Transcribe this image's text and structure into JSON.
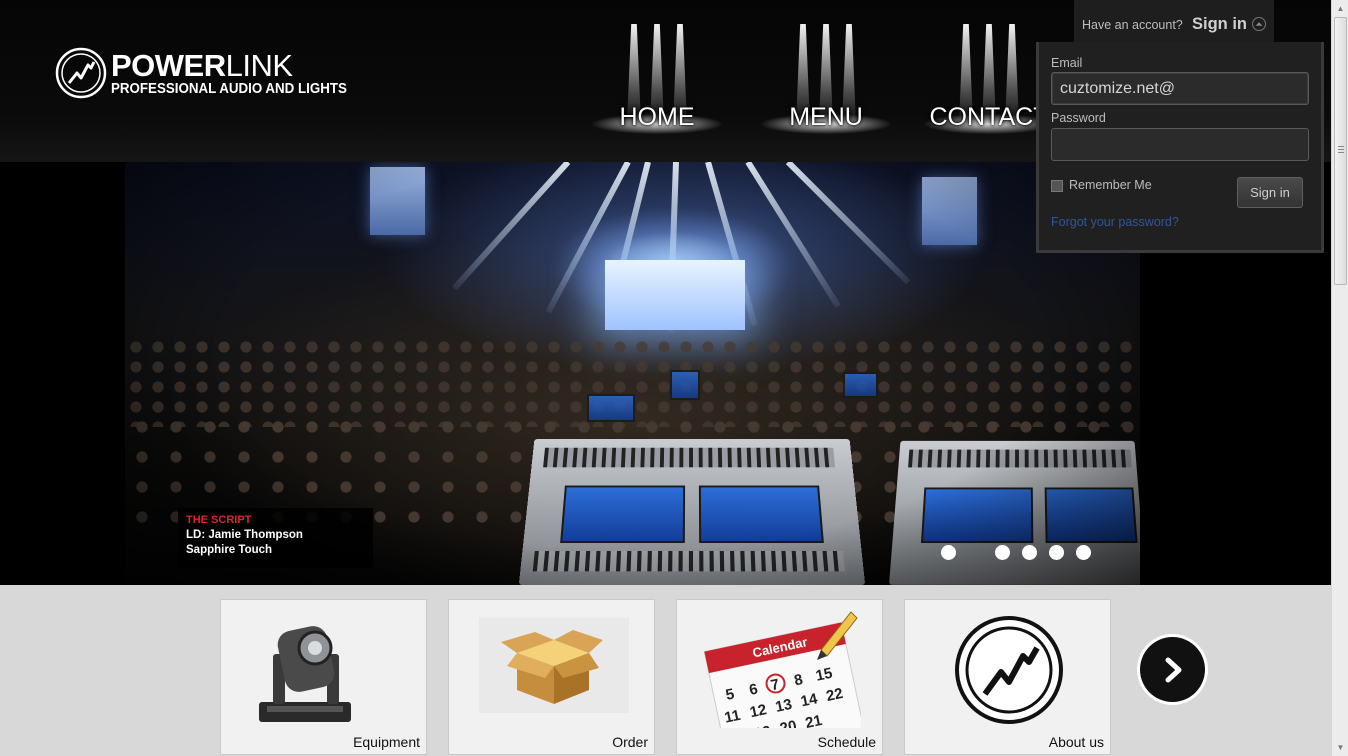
{
  "brand": {
    "name_bold": "POWER",
    "name_light": "LINK",
    "tagline": "PROFESSIONAL AUDIO AND LIGHTS"
  },
  "nav": {
    "items": [
      {
        "label": "HOME"
      },
      {
        "label": "MENU"
      },
      {
        "label": "CONTACT"
      }
    ]
  },
  "account": {
    "prompt": "Have an account?",
    "toggle_label": "Sign in",
    "email_label": "Email",
    "email_value": "cuztomize.net@",
    "password_label": "Password",
    "password_value": "",
    "remember_label": "Remember Me",
    "remember_checked": false,
    "submit_label": "Sign in",
    "forgot_label": "Forgot your password?"
  },
  "slider": {
    "caption_title": "THE SCRIPT",
    "caption_line1": "LD: Jamie Thompson",
    "caption_line2": "Sapphire Touch",
    "slide_count": 6,
    "active_index": 1
  },
  "tiles": [
    {
      "label": "Equipment",
      "icon": "moving-head-light-icon"
    },
    {
      "label": "Order",
      "icon": "open-box-icon"
    },
    {
      "label": "Schedule",
      "icon": "calendar-icon"
    },
    {
      "label": "About us",
      "icon": "powerlink-logo-icon"
    }
  ],
  "colors": {
    "caption_title": "#e0222e",
    "forgot_link": "#30569a",
    "header_bg": "#050505"
  }
}
